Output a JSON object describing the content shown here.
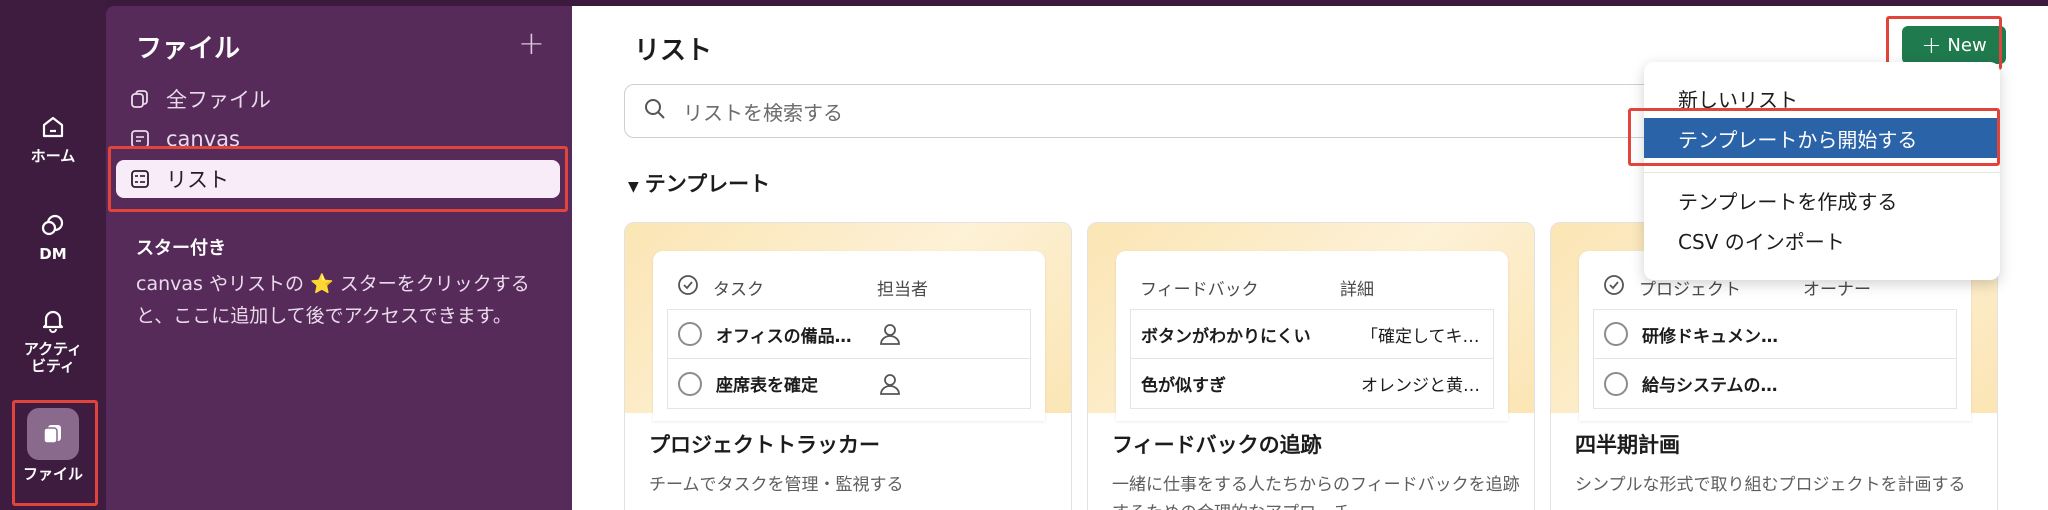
{
  "rail": {
    "home": "ホーム",
    "dm": "DM",
    "activity": "アクティ\nビティ",
    "files": "ファイル"
  },
  "sidebar": {
    "title": "ファイル",
    "items": [
      {
        "label": "全ファイル",
        "icon": "files-icon"
      },
      {
        "label": "canvas",
        "icon": "canvas-icon"
      },
      {
        "label": "リスト",
        "icon": "list-icon"
      }
    ],
    "starred_title": "スター付き",
    "starred_desc": "canvas やリストの ⭐ スターをクリックすると、ここに追加して後でアクセスできます。"
  },
  "main": {
    "title": "リスト",
    "search_placeholder": "リストを検索する",
    "section": "テンプレート",
    "new_button": "New"
  },
  "cards": [
    {
      "head1": "タスク",
      "head2": "担当者",
      "rows": [
        {
          "c1": "オフィスの備品…",
          "c2": ""
        },
        {
          "c1": "座席表を確定",
          "c2": ""
        }
      ],
      "name": "プロジェクトトラッカー",
      "desc": "チームでタスクを管理・監視する"
    },
    {
      "head1": "フィードバック",
      "head2": "詳細",
      "rows": [
        {
          "c1": "ボタンがわかりにくい",
          "c2": "「確定してキ…"
        },
        {
          "c1": "色が似すぎ",
          "c2": "オレンジと黄…"
        }
      ],
      "name": "フィードバックの追跡",
      "desc": "一緒に仕事をする人たちからのフィードバックを追跡するための合理的なアプローチ"
    },
    {
      "head1": "プロジェクト",
      "head2": "オーナー",
      "rows": [
        {
          "c1": "研修ドキュメン…",
          "c2": ""
        },
        {
          "c1": "給与システムの…",
          "c2": ""
        }
      ],
      "name": "四半期計画",
      "desc": "シンプルな形式で取り組むプロジェクトを計画する"
    }
  ],
  "dropdown": {
    "new_list": "新しいリスト",
    "from_template": "テンプレートから開始する",
    "create_template": "テンプレートを作成する",
    "import_csv": "CSV のインポート"
  }
}
